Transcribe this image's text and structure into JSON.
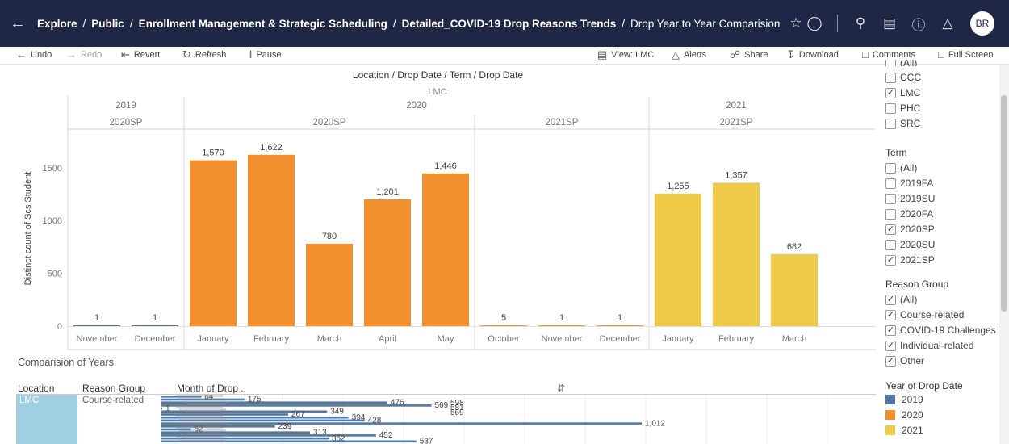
{
  "breadcrumbs": [
    "Explore",
    "Public",
    "Enrollment Management & Strategic Scheduling",
    "Detailed_COVID-19 Drop Reasons Trends",
    "Drop Year to Year Comparision"
  ],
  "avatar": "BR",
  "toolbar": {
    "undo": "Undo",
    "redo": "Redo",
    "revert": "Revert",
    "refresh": "Refresh",
    "pause": "Pause",
    "view": "View: LMC",
    "alerts": "Alerts",
    "share": "Share",
    "download": "Download",
    "comments": "Comments",
    "full_screen": "Full Screen"
  },
  "chart_data": {
    "type": "bar",
    "title": "Location / Drop Date / Term / Drop Date",
    "subtitle": "LMC",
    "ylabel": "Distinct count of Scs Student",
    "ylim": [
      0,
      1850
    ],
    "yticks": [
      0,
      500,
      1000,
      1500
    ],
    "years": [
      {
        "label": "2019",
        "terms": [
          {
            "label": "2020SP",
            "categories": [
              "November",
              "December"
            ],
            "values": [
              1,
              1
            ]
          }
        ]
      },
      {
        "label": "2020",
        "terms": [
          {
            "label": "2020SP",
            "categories": [
              "January",
              "February",
              "March",
              "April",
              "May"
            ],
            "values": [
              1570,
              1622,
              780,
              1201,
              1446
            ]
          },
          {
            "label": "2021SP",
            "categories": [
              "October",
              "November",
              "December"
            ],
            "values": [
              5,
              1,
              1
            ]
          }
        ]
      },
      {
        "label": "2021",
        "terms": [
          {
            "label": "2021SP",
            "categories": [
              "January",
              "February",
              "March"
            ],
            "values": [
              1255,
              1357,
              682
            ]
          }
        ]
      }
    ],
    "colors": {
      "2019": "#4e79a7",
      "2020": "#f28e2b",
      "2021": "#edc948"
    }
  },
  "comparison": {
    "title": "Comparision of Years",
    "headers": {
      "location": "Location",
      "reason_group": "Reason Group",
      "month": "Month of Drop .."
    },
    "location": "LMC",
    "reason_group": "Course-related",
    "bar_values": [
      84,
      175,
      476,
      569,
      1,
      349,
      267,
      394,
      428,
      1012,
      239,
      62,
      313,
      452,
      352,
      537
    ],
    "end_labels": [
      "598",
      "581",
      "569"
    ]
  },
  "filters": {
    "location_items": [
      {
        "label": "(All)",
        "checked": false
      },
      {
        "label": "CCC",
        "checked": false
      },
      {
        "label": "LMC",
        "checked": true
      },
      {
        "label": "PHC",
        "checked": false
      },
      {
        "label": "SRC",
        "checked": false
      }
    ],
    "term_title": "Term",
    "term_items": [
      {
        "label": "(All)",
        "checked": false
      },
      {
        "label": "2019FA",
        "checked": false
      },
      {
        "label": "2019SU",
        "checked": false
      },
      {
        "label": "2020FA",
        "checked": false
      },
      {
        "label": "2020SP",
        "checked": true
      },
      {
        "label": "2020SU",
        "checked": false
      },
      {
        "label": "2021SP",
        "checked": true
      }
    ],
    "reason_title": "Reason Group",
    "reason_items": [
      {
        "label": "(All)",
        "checked": true
      },
      {
        "label": "Course-related",
        "checked": true
      },
      {
        "label": "COVID-19 Challenges",
        "checked": true
      },
      {
        "label": "Individual-related",
        "checked": true
      },
      {
        "label": "Other",
        "checked": true
      }
    ],
    "legend_title": "Year of Drop Date",
    "legend": [
      {
        "label": "2019",
        "color": "#4e79a7"
      },
      {
        "label": "2020",
        "color": "#f28e2b"
      },
      {
        "label": "2021",
        "color": "#edc948"
      }
    ]
  }
}
